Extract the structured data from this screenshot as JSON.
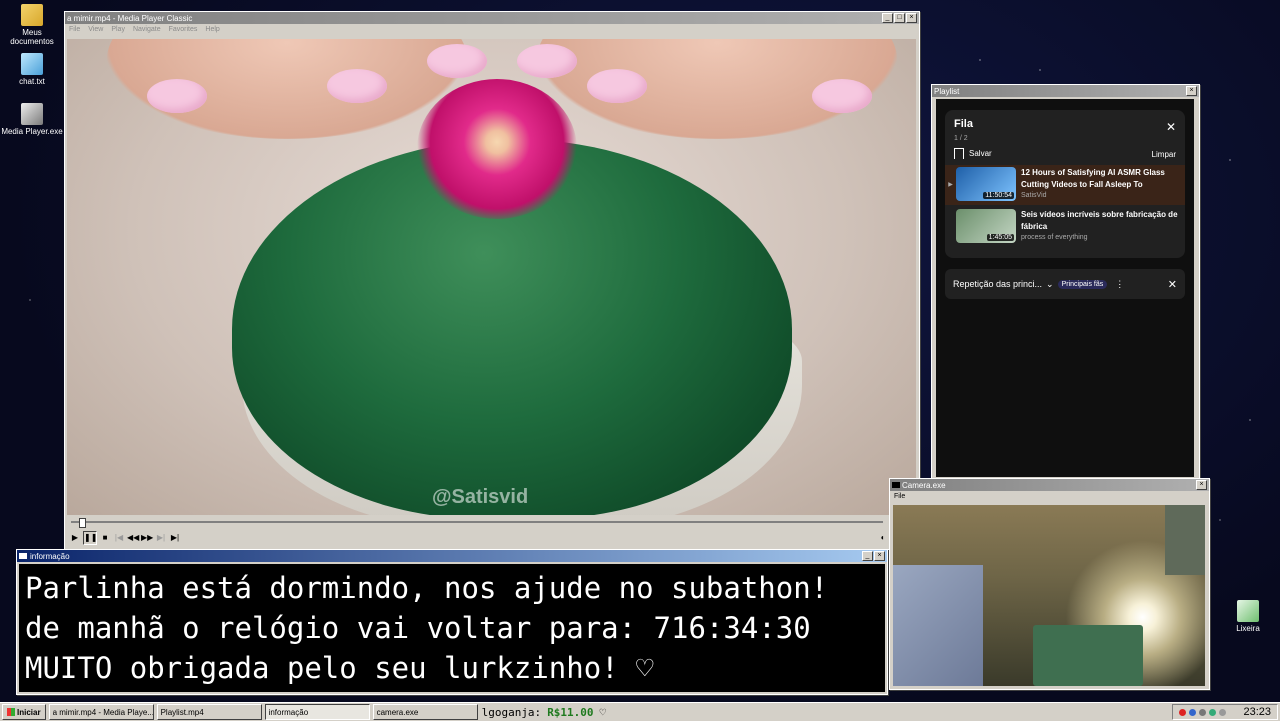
{
  "desktop": {
    "icons": [
      {
        "label": "Meus documentos",
        "name": "folder-icon"
      },
      {
        "label": "chat.txt",
        "name": "notepad-icon"
      },
      {
        "label": "Media Player.exe",
        "name": "media-player-icon"
      },
      {
        "label": "Lixeira",
        "name": "recycle-bin-icon"
      }
    ]
  },
  "media_player": {
    "title": "a mimir.mp4 - Media Player Classic",
    "menu": [
      "File",
      "View",
      "Play",
      "Navigate",
      "Favorites",
      "Help"
    ],
    "watermark": "@Satisvid",
    "progress": 0.01
  },
  "playlist": {
    "window_title": "Playlist",
    "heading": "Fila",
    "position": "1 / 2",
    "save_label": "Salvar",
    "clear_label": "Limpar",
    "items": [
      {
        "title": "12 Hours of Satisfying AI ASMR Glass Cutting Videos to Fall Asleep To",
        "channel": "SatisVid",
        "duration": "11:50:54",
        "current": true
      },
      {
        "title": "Seis vídeos incríveis sobre fabricação de fábrica",
        "channel": "process of everything",
        "duration": "1:45:05",
        "current": false
      }
    ],
    "related_label": "Repetição das princi...",
    "pill_label": "Principais fãs"
  },
  "camera": {
    "window_title": "Camera.exe",
    "menu": [
      "File"
    ]
  },
  "info": {
    "window_title": "informação",
    "lines": [
      "Parlinha está dormindo, nos ajude no subathon!",
      "de manhã o relógio vai voltar para:  716:34:30",
      "MUITO obrigada pelo seu lurkzinho! ♡"
    ]
  },
  "taskbar": {
    "start_label": "Iniciar",
    "tasks": [
      {
        "label": "a mimir.mp4 - Media Playe...",
        "active": false
      },
      {
        "label": "Playlist.mp4",
        "active": false
      },
      {
        "label": "informação",
        "active": true
      },
      {
        "label": "camera.exe",
        "active": false
      }
    ],
    "ticker_name": "lgoganja:",
    "ticker_money": "R$11.00",
    "ticker_heart": "♡",
    "clock": "23:23"
  }
}
